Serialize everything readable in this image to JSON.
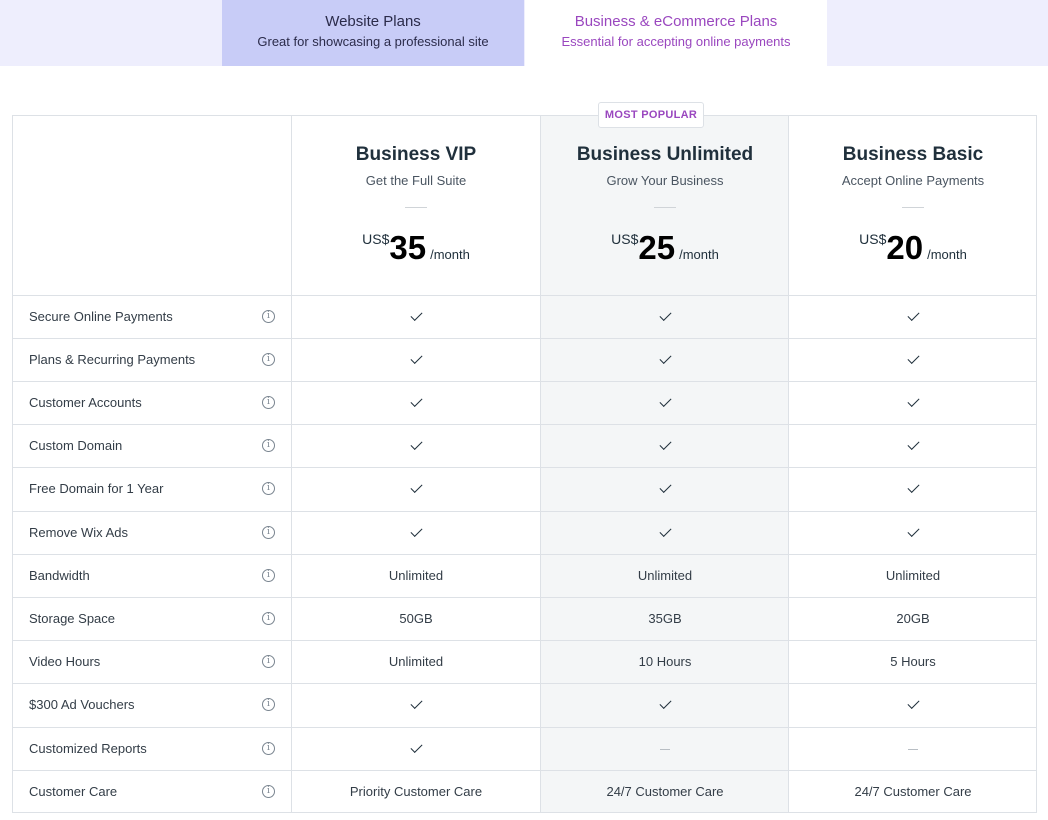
{
  "tabs": [
    {
      "title": "Website Plans",
      "subtitle": "Great for showcasing a professional site"
    },
    {
      "title": "Business & eCommerce Plans",
      "subtitle": "Essential for accepting online payments"
    }
  ],
  "badge": "MOST POPULAR",
  "plans": [
    {
      "name": "Business VIP",
      "tagline": "Get the Full Suite",
      "currency": "US$",
      "amount": "35",
      "period": "/month"
    },
    {
      "name": "Business Unlimited",
      "tagline": "Grow Your Business",
      "currency": "US$",
      "amount": "25",
      "period": "/month"
    },
    {
      "name": "Business Basic",
      "tagline": "Accept Online Payments",
      "currency": "US$",
      "amount": "20",
      "period": "/month"
    }
  ],
  "features": [
    {
      "label": "Secure Online Payments",
      "values": [
        "check",
        "check",
        "check"
      ]
    },
    {
      "label": "Plans & Recurring Payments",
      "values": [
        "check",
        "check",
        "check"
      ]
    },
    {
      "label": "Customer Accounts",
      "values": [
        "check",
        "check",
        "check"
      ]
    },
    {
      "label": "Custom Domain",
      "values": [
        "check",
        "check",
        "check"
      ]
    },
    {
      "label": "Free Domain for 1 Year",
      "values": [
        "check",
        "check",
        "check"
      ]
    },
    {
      "label": "Remove Wix Ads",
      "values": [
        "check",
        "check",
        "check"
      ]
    },
    {
      "label": "Bandwidth",
      "values": [
        "Unlimited",
        "Unlimited",
        "Unlimited"
      ]
    },
    {
      "label": "Storage Space",
      "values": [
        "50GB",
        "35GB",
        "20GB"
      ]
    },
    {
      "label": "Video Hours",
      "values": [
        "Unlimited",
        "10 Hours",
        "5 Hours"
      ]
    },
    {
      "label": "$300 Ad Vouchers",
      "values": [
        "check",
        "check",
        "check"
      ]
    },
    {
      "label": "Customized Reports",
      "values": [
        "check",
        "none",
        "none"
      ]
    },
    {
      "label": "Customer Care",
      "values": [
        "Priority Customer Care",
        "24/7 Customer Care",
        "24/7 Customer Care"
      ]
    }
  ],
  "icons": {
    "info": "info-icon",
    "check": "check-icon",
    "none": "dash-icon"
  },
  "colors": {
    "accent": "#9a47bf",
    "tab_active_bg": "#c8ccf7",
    "tabbar_bg": "#eeeefd",
    "highlight_col": "#f4f6f7"
  }
}
